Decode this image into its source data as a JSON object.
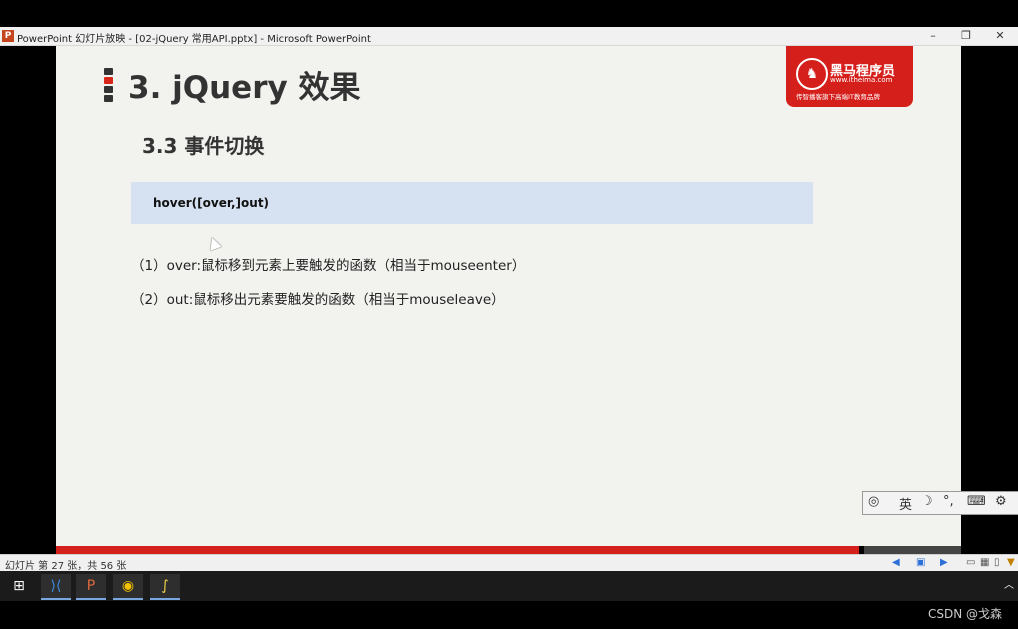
{
  "window": {
    "title": "PowerPoint 幻灯片放映 - [02-jQuery 常用API.pptx] - Microsoft PowerPoint",
    "app_icon": "P",
    "minimize": "–",
    "restore": "❐",
    "close": "✕"
  },
  "slide": {
    "title": "3. jQuery 效果",
    "subtitle": "3.3  事件切换",
    "code": "hover([over,]out)",
    "lines": [
      "（1）over:鼠标移到元素上要触发的函数（相当于mouseenter）",
      "（2）out:鼠标移出元素要触发的函数（相当于mouseleave）"
    ],
    "logo": {
      "name": "黑马程序员",
      "url": "www.itheima.com",
      "tagline": "传智播客旗下高端IT教育品牌",
      "accent": "#d51f1b"
    }
  },
  "ime": {
    "mode": "英",
    "icons": [
      "ime-logo-icon",
      "moon-icon",
      "punctuation-icon",
      "keyboard-icon",
      "gear-icon"
    ]
  },
  "status": {
    "slide_info": "幻灯片 第 27 张，共 56 张"
  },
  "taskbar": {
    "apps": [
      "windows-start-icon",
      "vscode-icon",
      "powerpoint-icon",
      "chrome-icon",
      "python-icon"
    ]
  },
  "watermark": "CSDN @戈森"
}
